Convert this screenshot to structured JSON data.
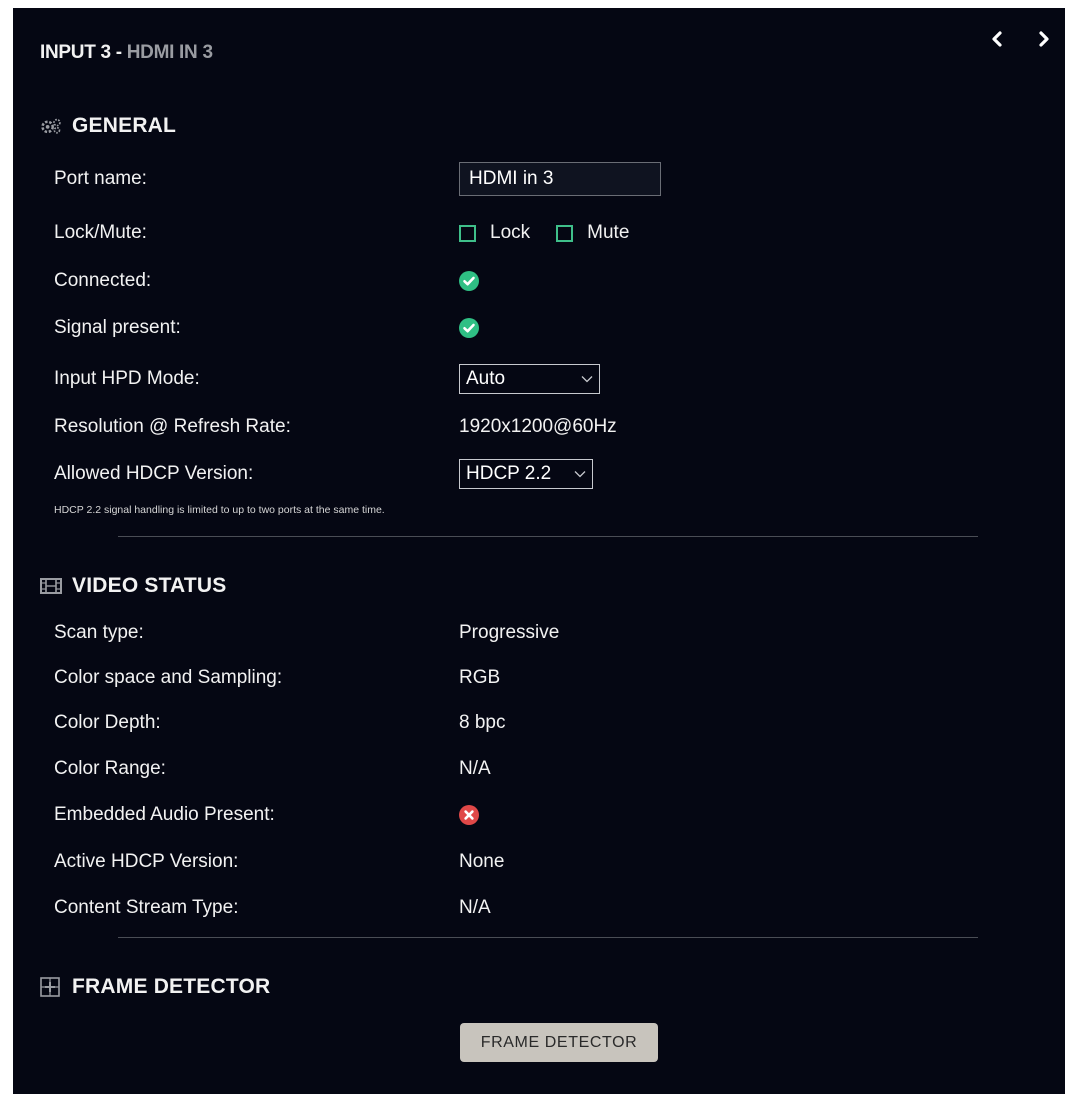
{
  "header": {
    "title_main": "INPUT 3 - ",
    "title_sub": "HDMI IN 3",
    "prev_icon": "chevron-left-icon",
    "next_icon": "chevron-right-icon"
  },
  "general": {
    "heading": "GENERAL",
    "icon": "gears-icon",
    "port_name_label": "Port name:",
    "port_name_value": "HDMI in 3",
    "lock_mute_label": "Lock/Mute:",
    "lock_label": "Lock",
    "mute_label": "Mute",
    "connected_label": "Connected:",
    "signal_label": "Signal present:",
    "hpd_label": "Input HPD Mode:",
    "hpd_value": "Auto",
    "resolution_label": "Resolution @ Refresh Rate:",
    "resolution_value": "1920x1200@60Hz",
    "hdcp_label": "Allowed HDCP Version:",
    "hdcp_value": "HDCP 2.2",
    "note": "HDCP 2.2 signal handling is limited to up to two ports at the same time."
  },
  "video_status": {
    "heading": "VIDEO STATUS",
    "icon": "film-icon",
    "rows": [
      {
        "label": "Scan type:",
        "value": "Progressive"
      },
      {
        "label": "Color space and Sampling:",
        "value": "RGB"
      },
      {
        "label": "Color Depth:",
        "value": "8 bpc"
      },
      {
        "label": "Color Range:",
        "value": "N/A"
      },
      {
        "label": "Embedded Audio Present:",
        "value": ""
      },
      {
        "label": "Active HDCP Version:",
        "value": "None"
      },
      {
        "label": "Content Stream Type:",
        "value": "N/A"
      }
    ]
  },
  "frame_detector": {
    "heading": "FRAME DETECTOR",
    "icon": "grid-icon",
    "button_label": "FRAME DETECTOR"
  },
  "colors": {
    "background": "#050713",
    "ok": "#2fbf84",
    "error": "#e04848",
    "checkbox": "#3fbf8a",
    "button": "#c8c4bd"
  }
}
